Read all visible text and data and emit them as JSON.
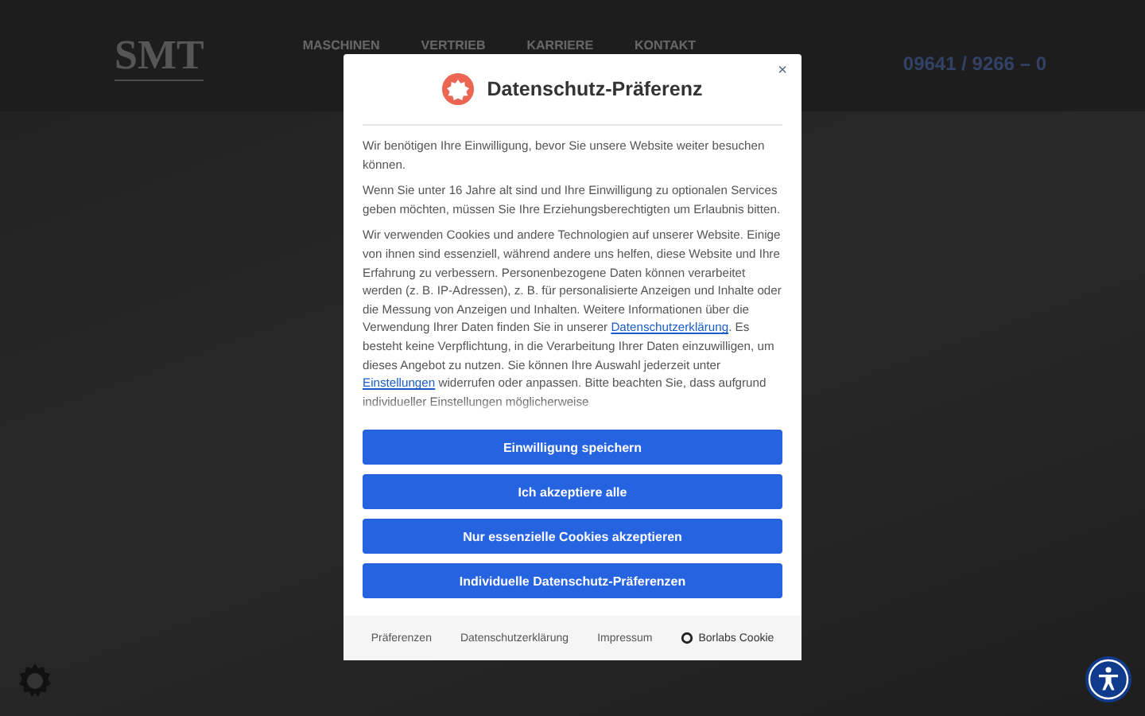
{
  "header": {
    "logo": "SMT",
    "nav": [
      "MASCHINEN",
      "VERTRIEB",
      "KARRIERE",
      "KONTAKT"
    ],
    "phone": "09641 / 9266 – 0"
  },
  "dialog": {
    "title": "Datenschutz-Präferenz",
    "close": "×",
    "paragraphs": [
      [
        {
          "kind": "text",
          "text": "Wir benötigen Ihre Einwilligung, bevor Sie unsere Website weiter besuchen können."
        }
      ],
      [
        {
          "kind": "text",
          "text": "Wenn Sie unter 16 Jahre alt sind und Ihre Einwilligung zu optionalen Services geben möchten, müssen Sie Ihre Erziehungsberechtigten um Erlaubnis bitten."
        }
      ],
      [
        {
          "kind": "text",
          "text": "Wir verwenden Cookies und andere Technologien auf unserer Website. Einige von ihnen sind essenziell, während andere uns helfen, diese Website und Ihre Erfahrung zu verbessern. Personenbezogene Daten können verarbeitet werden (z. B. IP-Adressen), z. B. für personalisierte Anzeigen und Inhalte oder die Messung von Anzeigen und Inhalten. Weitere Informationen über die Verwendung Ihrer Daten finden Sie in unserer "
        },
        {
          "kind": "link",
          "text": "Datenschutzerklärung"
        },
        {
          "kind": "text",
          "text": ". Es besteht keine Verpflichtung, in die Verarbeitung Ihrer Daten einzuwilligen, um dieses Angebot zu nutzen. Sie können Ihre Auswahl jederzeit unter "
        },
        {
          "kind": "link",
          "text": "Einstellungen"
        },
        {
          "kind": "text",
          "text": " widerrufen oder anpassen. Bitte beachten Sie, dass aufgrund individueller Einstellungen möglicherweise"
        }
      ]
    ],
    "buttons": [
      "Einwilligung speichern",
      "Ich akzeptiere alle",
      "Nur essenzielle Cookies akzeptieren",
      "Individuelle Datenschutz-Präferenzen"
    ],
    "footer": [
      {
        "kind": "link",
        "text": "Präferenzen"
      },
      {
        "kind": "link",
        "text": "Datenschutzerklärung"
      },
      {
        "kind": "link",
        "text": "Impressum"
      },
      {
        "kind": "brand",
        "text": "Borlabs Cookie"
      }
    ]
  }
}
